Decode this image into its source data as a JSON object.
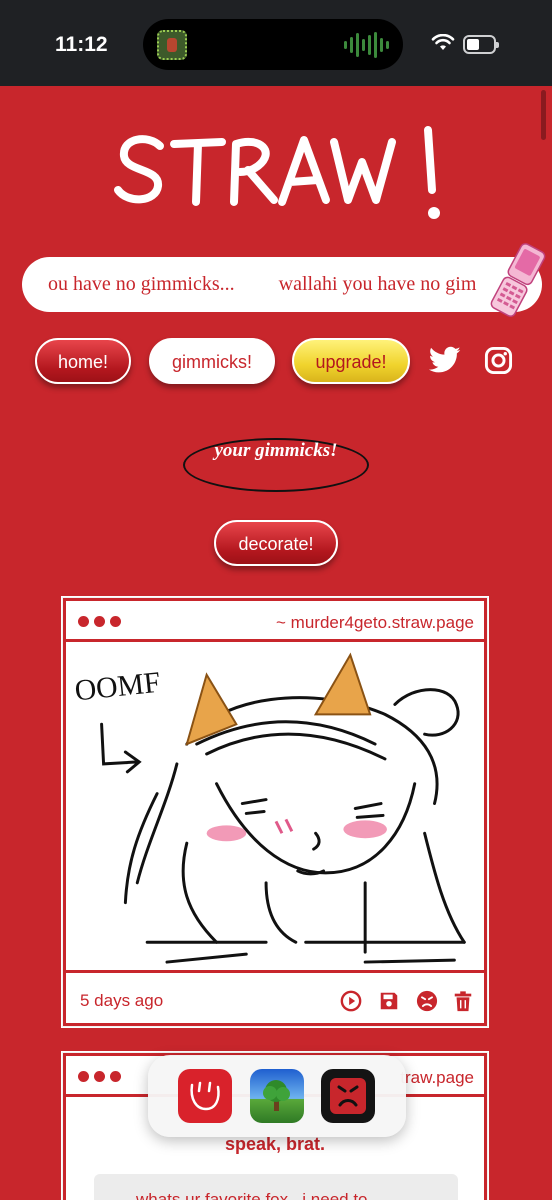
{
  "status_bar": {
    "time": "11:12"
  },
  "brand": {
    "logo_text": "STRAW!"
  },
  "marquee": {
    "text_1": "ou have no gimmicks...",
    "text_2": "wallahi you have no gim"
  },
  "nav": {
    "home": "home!",
    "gimmicks": "gimmicks!",
    "upgrade": "upgrade!"
  },
  "social": {
    "twitter": "twitter-icon",
    "instagram": "instagram-icon"
  },
  "page": {
    "heading": "your gimmicks!",
    "decorate": "decorate!"
  },
  "cards": [
    {
      "url": "~ murder4geto.straw.page",
      "drawing_caption": "OOMF",
      "time_ago": "5 days ago",
      "actions": [
        "play-icon",
        "save-icon",
        "angry-face-icon",
        "trash-icon"
      ]
    },
    {
      "url_fragment": "traw.page",
      "prompt": "speak, brat.",
      "question": "whats ur favorite fox.. i need to"
    }
  ],
  "dock": {
    "apps": [
      "straw-app-icon",
      "landscape-app-icon",
      "angry-app-icon"
    ]
  },
  "colors": {
    "brand_red": "#c8262c",
    "yellow": "#f0d32c",
    "status_bar": "#1f2124"
  }
}
